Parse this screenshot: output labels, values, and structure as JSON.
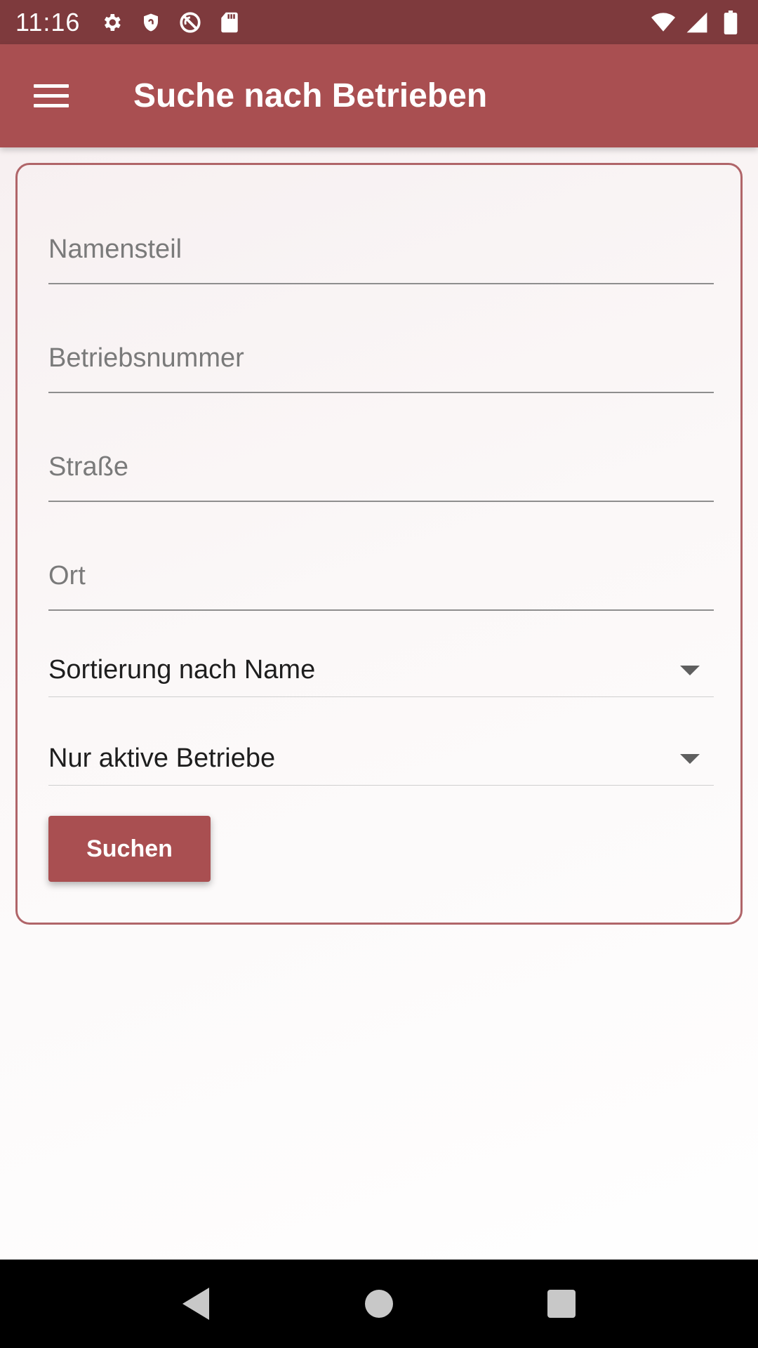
{
  "status_bar": {
    "time": "11:16",
    "left_icons": [
      "gear-icon",
      "shield-icon",
      "no-sync-icon",
      "sd-card-icon"
    ],
    "right_icons": [
      "wifi-icon",
      "cell-signal-icon",
      "battery-icon"
    ]
  },
  "app_bar": {
    "title": "Suche nach Betrieben",
    "menu_icon": "hamburger-menu-icon",
    "color": "#a94f51"
  },
  "form": {
    "fields": [
      {
        "placeholder": "Namensteil",
        "value": ""
      },
      {
        "placeholder": "Betriebsnummer",
        "value": ""
      },
      {
        "placeholder": "Straße",
        "value": ""
      },
      {
        "placeholder": "Ort",
        "value": ""
      }
    ],
    "sort_select": {
      "selected": "Sortierung nach Name"
    },
    "status_select": {
      "selected": "Nur aktive Betriebe"
    },
    "search_button": "Suchen",
    "border_color": "#b06569"
  },
  "nav_bar": {
    "icons": [
      "back-triangle-icon",
      "home-circle-icon",
      "recents-square-icon"
    ]
  }
}
